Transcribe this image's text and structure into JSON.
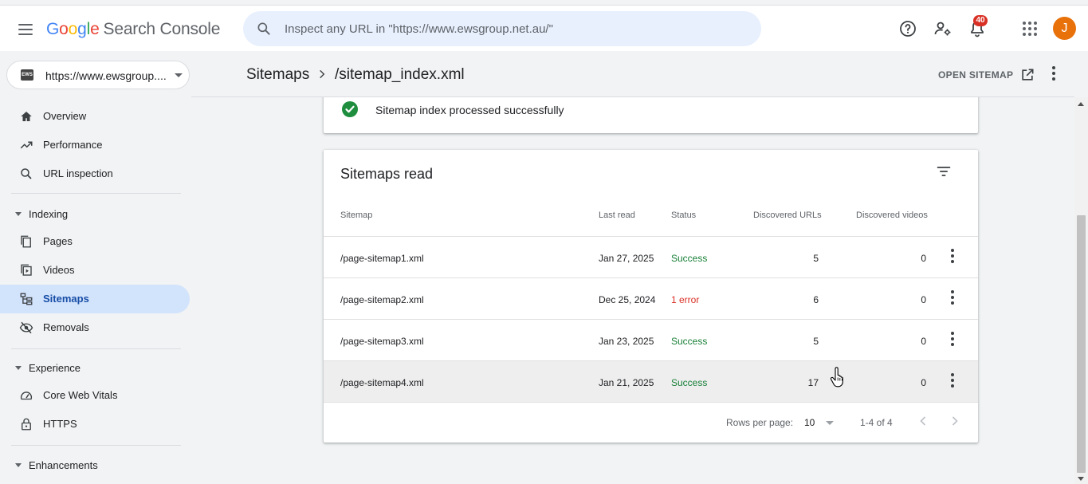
{
  "header": {
    "logo_google": [
      "G",
      "o",
      "o",
      "g",
      "l",
      "e"
    ],
    "logo_product": "Search Console",
    "search_placeholder": "Inspect any URL in \"https://www.ewsgroup.net.au/\"",
    "notification_count": "40",
    "avatar_letter": "J",
    "icons": [
      "menu-icon",
      "search-icon",
      "help-icon",
      "manage-users-icon",
      "notifications-icon",
      "apps-grid-icon"
    ]
  },
  "property": {
    "favicon_text": "EWS",
    "url": "https://www.ewsgroup...."
  },
  "sidebar": {
    "items": [
      {
        "label": "Overview",
        "icon": "home-icon"
      },
      {
        "label": "Performance",
        "icon": "trending-up-icon"
      },
      {
        "label": "URL inspection",
        "icon": "search-icon"
      }
    ],
    "indexing": {
      "label": "Indexing",
      "items": [
        {
          "label": "Pages",
          "icon": "pages-icon"
        },
        {
          "label": "Videos",
          "icon": "video-icon"
        },
        {
          "label": "Sitemaps",
          "icon": "sitemap-icon"
        },
        {
          "label": "Removals",
          "icon": "visibility-off-icon"
        }
      ]
    },
    "experience": {
      "label": "Experience",
      "items": [
        {
          "label": "Core Web Vitals",
          "icon": "speed-gauge-icon"
        },
        {
          "label": "HTTPS",
          "icon": "lock-icon"
        }
      ]
    },
    "enhancements": {
      "label": "Enhancements"
    }
  },
  "page": {
    "breadcrumb_root": "Sitemaps",
    "breadcrumb_current": "/sitemap_index.xml",
    "open_sitemap_label": "OPEN SITEMAP"
  },
  "status_card": {
    "message": "Sitemap index processed successfully"
  },
  "table": {
    "title": "Sitemaps read",
    "columns": [
      "Sitemap",
      "Last read",
      "Status",
      "Discovered URLs",
      "Discovered videos"
    ],
    "rows": [
      {
        "sitemap": "/page-sitemap1.xml",
        "last_read": "Jan 27, 2025",
        "status": "Success",
        "urls": "5",
        "videos": "0"
      },
      {
        "sitemap": "/page-sitemap2.xml",
        "last_read": "Dec 25, 2024",
        "status": "1 error",
        "urls": "6",
        "videos": "0"
      },
      {
        "sitemap": "/page-sitemap3.xml",
        "last_read": "Jan 23, 2025",
        "status": "Success",
        "urls": "5",
        "videos": "0"
      },
      {
        "sitemap": "/page-sitemap4.xml",
        "last_read": "Jan 21, 2025",
        "status": "Success",
        "urls": "17",
        "videos": "0"
      }
    ],
    "rows_per_page_label": "Rows per page:",
    "rows_per_page_value": "10",
    "range_label": "1-4 of 4"
  },
  "colors": {
    "accent": "#1a73e8",
    "success": "#188038",
    "error": "#d93025",
    "active_nav": "#d2e3fc",
    "avatar": "#e8710a"
  }
}
